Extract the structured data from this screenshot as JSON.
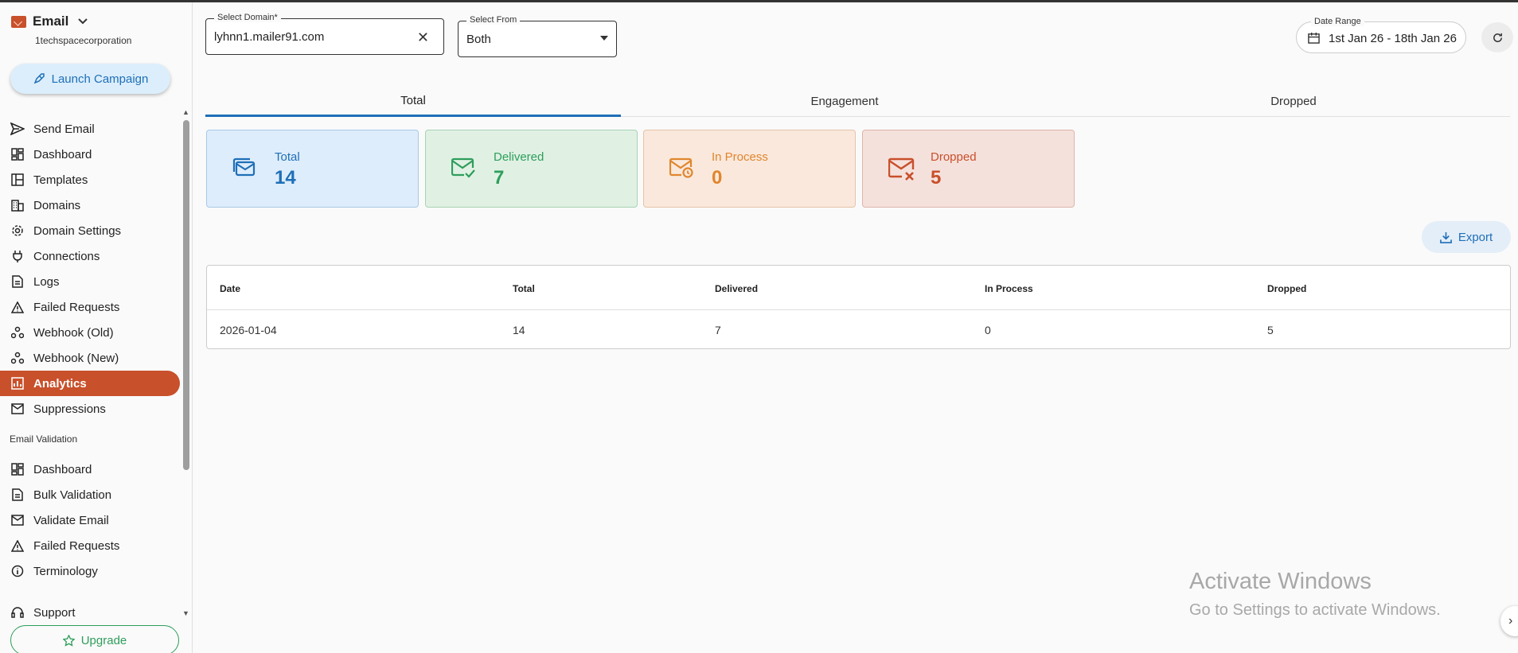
{
  "app": {
    "title": "Email",
    "org": "1techspacecorporation"
  },
  "sidebar": {
    "launch_label": "Launch Campaign",
    "items": [
      {
        "label": "Send Email",
        "icon": "send-icon"
      },
      {
        "label": "Dashboard",
        "icon": "dashboard-icon"
      },
      {
        "label": "Templates",
        "icon": "templates-icon"
      },
      {
        "label": "Domains",
        "icon": "building-icon"
      },
      {
        "label": "Domain Settings",
        "icon": "gear-icon"
      },
      {
        "label": "Connections",
        "icon": "plug-icon"
      },
      {
        "label": "Logs",
        "icon": "document-icon"
      },
      {
        "label": "Failed Requests",
        "icon": "warning-icon"
      },
      {
        "label": "Webhook (Old)",
        "icon": "webhook-icon"
      },
      {
        "label": "Webhook (New)",
        "icon": "webhook-icon"
      },
      {
        "label": "Analytics",
        "icon": "analytics-icon",
        "active": true
      },
      {
        "label": "Suppressions",
        "icon": "mail-block-icon"
      }
    ],
    "section_label": "Email Validation",
    "validation_items": [
      {
        "label": "Dashboard",
        "icon": "dashboard-icon"
      },
      {
        "label": "Bulk Validation",
        "icon": "document-icon"
      },
      {
        "label": "Validate Email",
        "icon": "mail-icon"
      },
      {
        "label": "Failed Requests",
        "icon": "warning-icon"
      },
      {
        "label": "Terminology",
        "icon": "info-icon"
      }
    ],
    "support_label": "Support",
    "upgrade_label": "Upgrade"
  },
  "filters": {
    "domain_label": "Select Domain*",
    "domain_value": "lyhnn1.mailer91.com",
    "from_label": "Select From",
    "from_value": "Both",
    "date_label": "Date Range",
    "date_value": "1st Jan 26 - 18th Jan 26"
  },
  "tabs": [
    {
      "label": "Total",
      "active": true
    },
    {
      "label": "Engagement"
    },
    {
      "label": "Dropped"
    }
  ],
  "cards": [
    {
      "label": "Total",
      "value": "14",
      "color": "#1e6fb8"
    },
    {
      "label": "Delivered",
      "value": "7",
      "color": "#2e9e5b"
    },
    {
      "label": "In Process",
      "value": "0",
      "color": "#e0862d"
    },
    {
      "label": "Dropped",
      "value": "5",
      "color": "#c8502b"
    }
  ],
  "export_label": "Export",
  "table": {
    "columns": [
      "Date",
      "Total",
      "Delivered",
      "In Process",
      "Dropped"
    ],
    "rows": [
      [
        "2026-01-04",
        "14",
        "7",
        "0",
        "5"
      ]
    ]
  },
  "watermark": {
    "line1": "Activate Windows",
    "line2": "Go to Settings to activate Windows."
  }
}
